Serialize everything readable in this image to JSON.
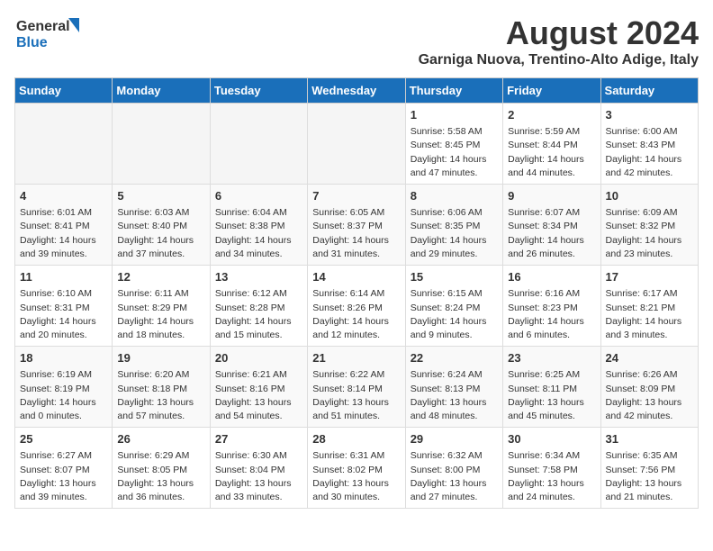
{
  "header": {
    "logo_line1": "General",
    "logo_line2": "Blue",
    "main_title": "August 2024",
    "subtitle": "Garniga Nuova, Trentino-Alto Adige, Italy"
  },
  "days_of_week": [
    "Sunday",
    "Monday",
    "Tuesday",
    "Wednesday",
    "Thursday",
    "Friday",
    "Saturday"
  ],
  "weeks": [
    [
      {
        "day": "",
        "info": ""
      },
      {
        "day": "",
        "info": ""
      },
      {
        "day": "",
        "info": ""
      },
      {
        "day": "",
        "info": ""
      },
      {
        "day": "1",
        "info": "Sunrise: 5:58 AM\nSunset: 8:45 PM\nDaylight: 14 hours\nand 47 minutes."
      },
      {
        "day": "2",
        "info": "Sunrise: 5:59 AM\nSunset: 8:44 PM\nDaylight: 14 hours\nand 44 minutes."
      },
      {
        "day": "3",
        "info": "Sunrise: 6:00 AM\nSunset: 8:43 PM\nDaylight: 14 hours\nand 42 minutes."
      }
    ],
    [
      {
        "day": "4",
        "info": "Sunrise: 6:01 AM\nSunset: 8:41 PM\nDaylight: 14 hours\nand 39 minutes."
      },
      {
        "day": "5",
        "info": "Sunrise: 6:03 AM\nSunset: 8:40 PM\nDaylight: 14 hours\nand 37 minutes."
      },
      {
        "day": "6",
        "info": "Sunrise: 6:04 AM\nSunset: 8:38 PM\nDaylight: 14 hours\nand 34 minutes."
      },
      {
        "day": "7",
        "info": "Sunrise: 6:05 AM\nSunset: 8:37 PM\nDaylight: 14 hours\nand 31 minutes."
      },
      {
        "day": "8",
        "info": "Sunrise: 6:06 AM\nSunset: 8:35 PM\nDaylight: 14 hours\nand 29 minutes."
      },
      {
        "day": "9",
        "info": "Sunrise: 6:07 AM\nSunset: 8:34 PM\nDaylight: 14 hours\nand 26 minutes."
      },
      {
        "day": "10",
        "info": "Sunrise: 6:09 AM\nSunset: 8:32 PM\nDaylight: 14 hours\nand 23 minutes."
      }
    ],
    [
      {
        "day": "11",
        "info": "Sunrise: 6:10 AM\nSunset: 8:31 PM\nDaylight: 14 hours\nand 20 minutes."
      },
      {
        "day": "12",
        "info": "Sunrise: 6:11 AM\nSunset: 8:29 PM\nDaylight: 14 hours\nand 18 minutes."
      },
      {
        "day": "13",
        "info": "Sunrise: 6:12 AM\nSunset: 8:28 PM\nDaylight: 14 hours\nand 15 minutes."
      },
      {
        "day": "14",
        "info": "Sunrise: 6:14 AM\nSunset: 8:26 PM\nDaylight: 14 hours\nand 12 minutes."
      },
      {
        "day": "15",
        "info": "Sunrise: 6:15 AM\nSunset: 8:24 PM\nDaylight: 14 hours\nand 9 minutes."
      },
      {
        "day": "16",
        "info": "Sunrise: 6:16 AM\nSunset: 8:23 PM\nDaylight: 14 hours\nand 6 minutes."
      },
      {
        "day": "17",
        "info": "Sunrise: 6:17 AM\nSunset: 8:21 PM\nDaylight: 14 hours\nand 3 minutes."
      }
    ],
    [
      {
        "day": "18",
        "info": "Sunrise: 6:19 AM\nSunset: 8:19 PM\nDaylight: 14 hours\nand 0 minutes."
      },
      {
        "day": "19",
        "info": "Sunrise: 6:20 AM\nSunset: 8:18 PM\nDaylight: 13 hours\nand 57 minutes."
      },
      {
        "day": "20",
        "info": "Sunrise: 6:21 AM\nSunset: 8:16 PM\nDaylight: 13 hours\nand 54 minutes."
      },
      {
        "day": "21",
        "info": "Sunrise: 6:22 AM\nSunset: 8:14 PM\nDaylight: 13 hours\nand 51 minutes."
      },
      {
        "day": "22",
        "info": "Sunrise: 6:24 AM\nSunset: 8:13 PM\nDaylight: 13 hours\nand 48 minutes."
      },
      {
        "day": "23",
        "info": "Sunrise: 6:25 AM\nSunset: 8:11 PM\nDaylight: 13 hours\nand 45 minutes."
      },
      {
        "day": "24",
        "info": "Sunrise: 6:26 AM\nSunset: 8:09 PM\nDaylight: 13 hours\nand 42 minutes."
      }
    ],
    [
      {
        "day": "25",
        "info": "Sunrise: 6:27 AM\nSunset: 8:07 PM\nDaylight: 13 hours\nand 39 minutes."
      },
      {
        "day": "26",
        "info": "Sunrise: 6:29 AM\nSunset: 8:05 PM\nDaylight: 13 hours\nand 36 minutes."
      },
      {
        "day": "27",
        "info": "Sunrise: 6:30 AM\nSunset: 8:04 PM\nDaylight: 13 hours\nand 33 minutes."
      },
      {
        "day": "28",
        "info": "Sunrise: 6:31 AM\nSunset: 8:02 PM\nDaylight: 13 hours\nand 30 minutes."
      },
      {
        "day": "29",
        "info": "Sunrise: 6:32 AM\nSunset: 8:00 PM\nDaylight: 13 hours\nand 27 minutes."
      },
      {
        "day": "30",
        "info": "Sunrise: 6:34 AM\nSunset: 7:58 PM\nDaylight: 13 hours\nand 24 minutes."
      },
      {
        "day": "31",
        "info": "Sunrise: 6:35 AM\nSunset: 7:56 PM\nDaylight: 13 hours\nand 21 minutes."
      }
    ]
  ]
}
